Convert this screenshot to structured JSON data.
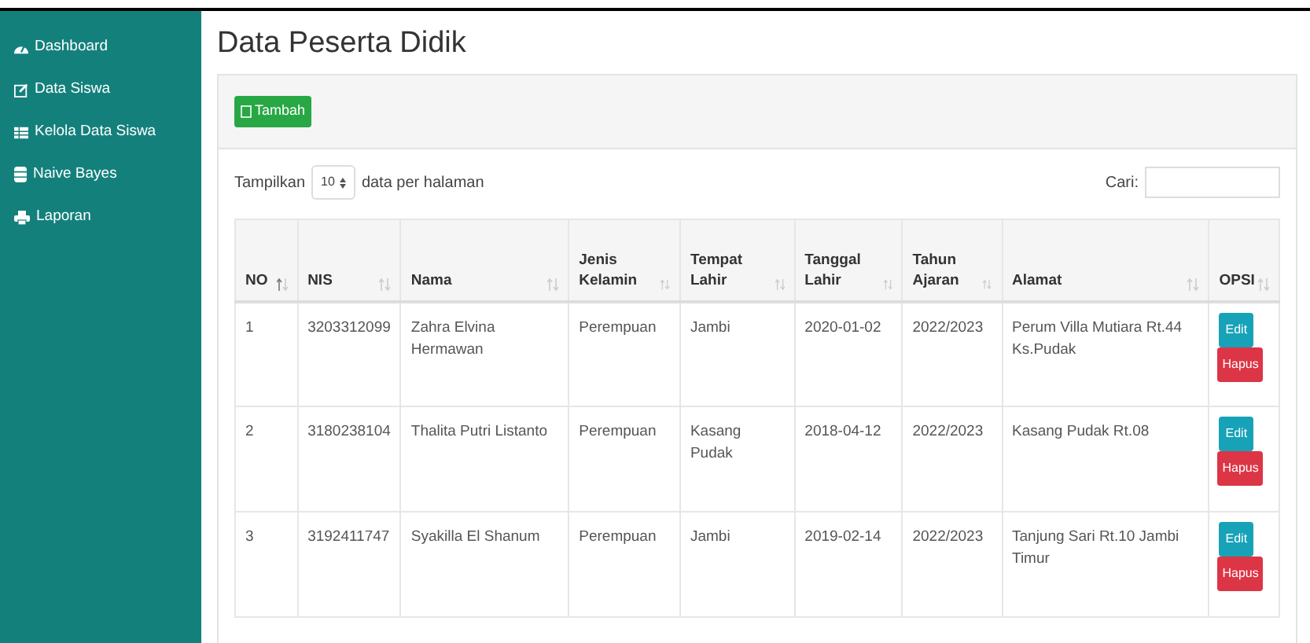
{
  "sidebar": {
    "items": [
      {
        "label": "Dashboard"
      },
      {
        "label": "Data Siswa"
      },
      {
        "label": "Kelola Data Siswa"
      },
      {
        "label": "Naive Bayes"
      },
      {
        "label": "Laporan"
      }
    ]
  },
  "title": "Data Peserta Didik",
  "add_button": "Tambah",
  "length_menu": {
    "before": "Tampilkan",
    "value": "10",
    "after": "data per halaman"
  },
  "search": {
    "label": "Cari:"
  },
  "table": {
    "columns": [
      "NO",
      "NIS",
      "Nama",
      "Jenis Kelamin",
      "Tempat Lahir",
      "Tanggal Lahir",
      "Tahun Ajaran",
      "Alamat",
      "OPSI"
    ],
    "rows": [
      {
        "cells": [
          "1",
          "3203312099",
          "Zahra Elvina Hermawan",
          "Perempuan",
          "Jambi",
          "2020-01-02",
          "2022/2023",
          "Perum Villa Mutiara Rt.44 Ks.Pudak"
        ],
        "actions": [
          "Edit",
          "Hapus"
        ]
      },
      {
        "cells": [
          "2",
          "3180238104",
          "Thalita Putri Listanto",
          "Perempuan",
          "Kasang Pudak",
          "2018-04-12",
          "2022/2023",
          "Kasang Pudak Rt.08"
        ],
        "actions": [
          "Edit",
          "Hapus"
        ]
      },
      {
        "cells": [
          "3",
          "3192411747",
          "Syakilla El Shanum",
          "Perempuan",
          "Jambi",
          "2019-02-14",
          "2022/2023",
          "Tanjung Sari Rt.10 Jambi Timur"
        ],
        "actions": [
          "Edit",
          "Hapus"
        ]
      }
    ]
  }
}
